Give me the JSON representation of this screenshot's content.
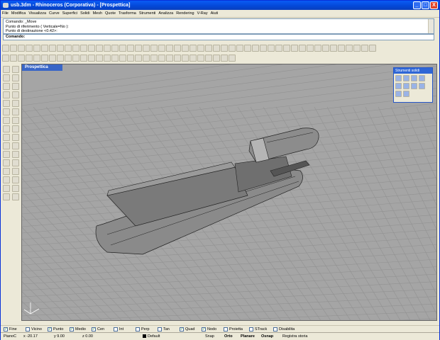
{
  "window": {
    "title": "usb.3dm - Rhinoceros (Corporativa) - [Prospettica]",
    "btn_min": "_",
    "btn_max": "□",
    "btn_close": "X"
  },
  "menu": [
    "File",
    "Modifica",
    "Visualizza",
    "Curve",
    "Superfici",
    "Solidi",
    "Mesh",
    "Quote",
    "Trasforma",
    "Strumenti",
    "Analizza",
    "Rendering",
    "V-Ray",
    "Aiuti"
  ],
  "command_history": [
    "Comando: _Move",
    "Punto di riferimento ( Verticale=No ):",
    "Punto di destinazione <0.42>:"
  ],
  "command_prompt": "Comando:",
  "viewport": {
    "title": "Prospettica"
  },
  "solid_panel": {
    "title": "Strumenti solidi"
  },
  "osnap": [
    {
      "label": "Fine",
      "checked": true
    },
    {
      "label": "Vicino",
      "checked": false
    },
    {
      "label": "Punto",
      "checked": true
    },
    {
      "label": "Medio",
      "checked": true
    },
    {
      "label": "Cen",
      "checked": true
    },
    {
      "label": "Int",
      "checked": false
    },
    {
      "label": "Perp",
      "checked": false
    },
    {
      "label": "Tan",
      "checked": false
    },
    {
      "label": "Quad",
      "checked": true
    },
    {
      "label": "Nodo",
      "checked": true
    },
    {
      "label": "Proietta",
      "checked": false
    },
    {
      "label": "STrack",
      "checked": false
    },
    {
      "label": "Disabilita",
      "checked": false
    }
  ],
  "status": {
    "plane": "PianoC",
    "x": "x -20.17",
    "y": "y 9.00",
    "z": "z 0.00",
    "layer": "Default",
    "snap": "Snap",
    "ortho": "Orto",
    "planar": "Planare",
    "osnap": "Osnap",
    "history": "Registra storia"
  }
}
